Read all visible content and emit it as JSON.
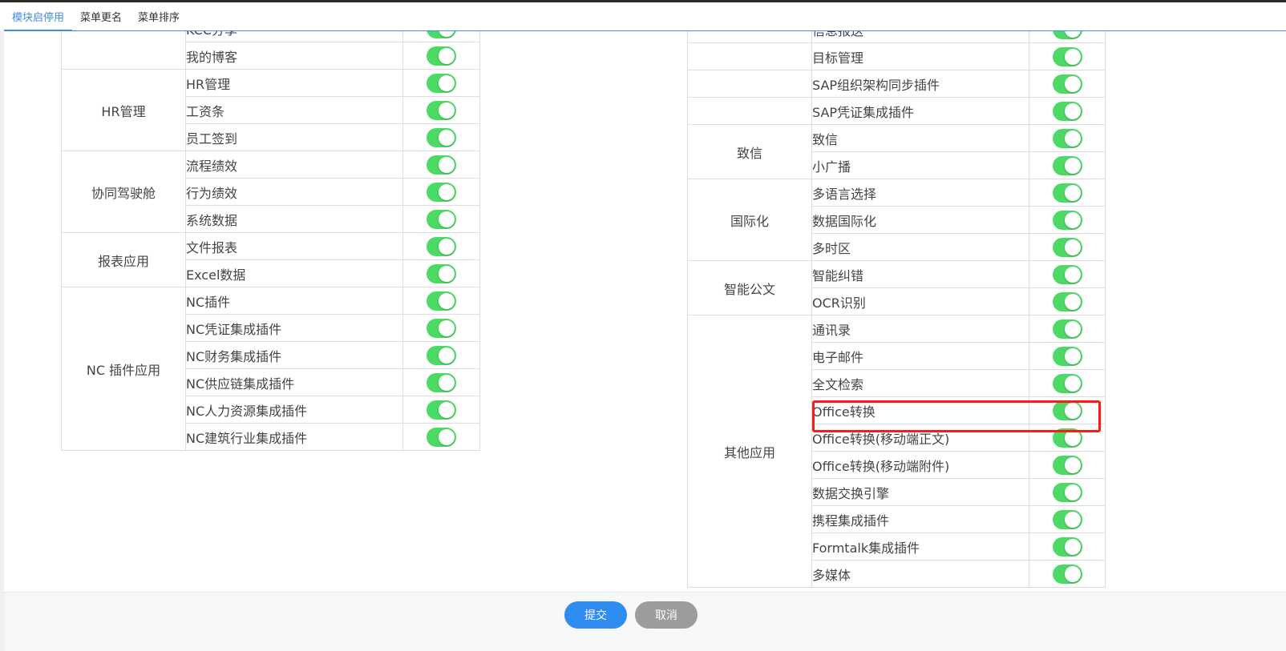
{
  "tabs": [
    "模块启停用",
    "菜单更名",
    "菜单排序"
  ],
  "left_table": {
    "partial_top": "KCC分享",
    "rows": [
      {
        "group": "",
        "item": "我的博客",
        "on": true
      },
      {
        "group": "HR管理",
        "item": "HR管理",
        "on": true
      },
      {
        "group": "HR管理",
        "item": "工资条",
        "on": true
      },
      {
        "group": "HR管理",
        "item": "员工签到",
        "on": true
      },
      {
        "group": "协同驾驶舱",
        "item": "流程绩效",
        "on": true
      },
      {
        "group": "协同驾驶舱",
        "item": "行为绩效",
        "on": true
      },
      {
        "group": "协同驾驶舱",
        "item": "系统数据",
        "on": true
      },
      {
        "group": "报表应用",
        "item": "文件报表",
        "on": true
      },
      {
        "group": "报表应用",
        "item": "Excel数据",
        "on": true
      },
      {
        "group": "NC 插件应用",
        "item": "NC插件",
        "on": true
      },
      {
        "group": "NC 插件应用",
        "item": "NC凭证集成插件",
        "on": true
      },
      {
        "group": "NC 插件应用",
        "item": "NC财务集成插件",
        "on": true
      },
      {
        "group": "NC 插件应用",
        "item": "NC供应链集成插件",
        "on": true
      },
      {
        "group": "NC 插件应用",
        "item": "NC人力资源集成插件",
        "on": true
      },
      {
        "group": "NC 插件应用",
        "item": "NC建筑行业集成插件",
        "on": true
      }
    ]
  },
  "right_table": {
    "partial_top": "信息报送",
    "rows": [
      {
        "group": "",
        "item": "目标管理",
        "on": true
      },
      {
        "group": "",
        "item": "SAP组织架构同步插件",
        "on": true
      },
      {
        "group": "",
        "item": "SAP凭证集成插件",
        "on": true
      },
      {
        "group": "致信",
        "item": "致信",
        "on": true
      },
      {
        "group": "致信",
        "item": "小广播",
        "on": true
      },
      {
        "group": "国际化",
        "item": "多语言选择",
        "on": true
      },
      {
        "group": "国际化",
        "item": "数据国际化",
        "on": true
      },
      {
        "group": "国际化",
        "item": "多时区",
        "on": true
      },
      {
        "group": "智能公文",
        "item": "智能纠错",
        "on": true
      },
      {
        "group": "智能公文",
        "item": "OCR识别",
        "on": true
      },
      {
        "group": "其他应用",
        "item": "通讯录",
        "on": true
      },
      {
        "group": "其他应用",
        "item": "电子邮件",
        "on": true
      },
      {
        "group": "其他应用",
        "item": "全文检索",
        "on": true
      },
      {
        "group": "其他应用",
        "item": "Office转换",
        "on": true
      },
      {
        "group": "其他应用",
        "item": "Office转换(移动端正文)",
        "on": true
      },
      {
        "group": "其他应用",
        "item": "Office转换(移动端附件)",
        "on": true
      },
      {
        "group": "其他应用",
        "item": "数据交换引擎",
        "on": true
      },
      {
        "group": "其他应用",
        "item": "携程集成插件",
        "on": true
      },
      {
        "group": "其他应用",
        "item": "Formtalk集成插件",
        "on": true
      },
      {
        "group": "其他应用",
        "item": "多媒体",
        "on": true
      }
    ]
  },
  "footer": {
    "submit": "提交",
    "cancel": "取消"
  },
  "colors": {
    "accent": "#2f8cf0",
    "toggle_on": "#4cd964",
    "highlight": "#ff1a1a"
  }
}
